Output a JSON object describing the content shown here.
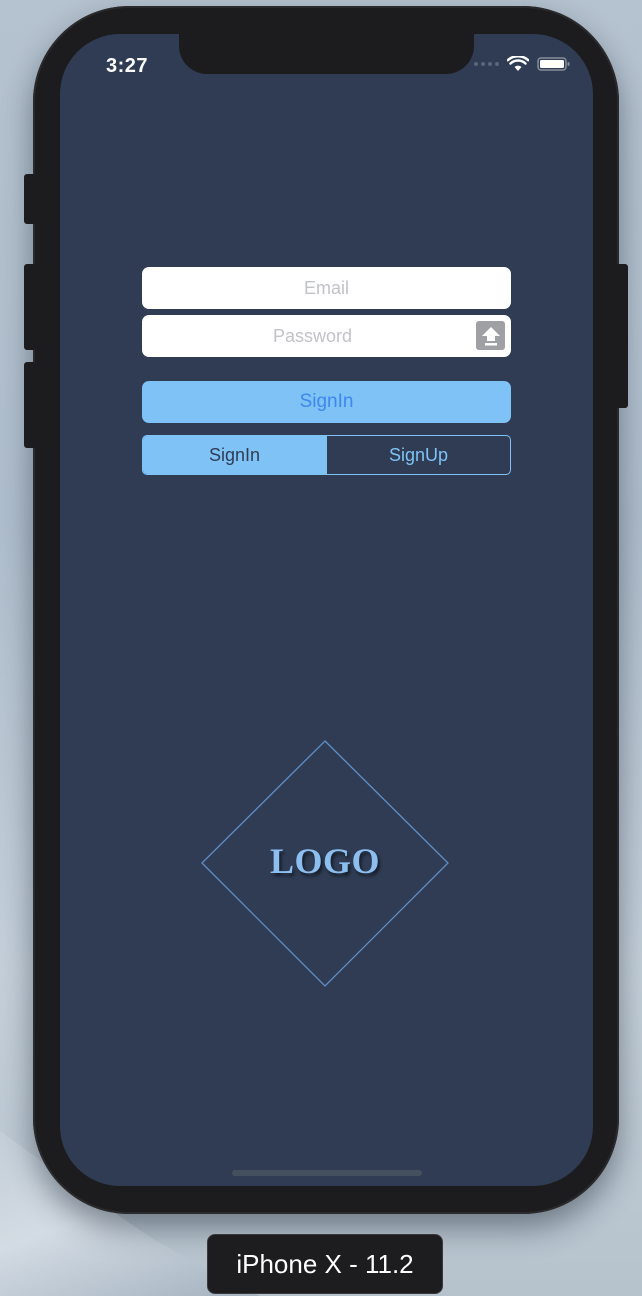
{
  "status_bar": {
    "time": "3:27"
  },
  "form": {
    "email_placeholder": "Email",
    "password_placeholder": "Password",
    "submit_label": "SignIn"
  },
  "segmented_control": {
    "selected": "SignIn",
    "options": [
      "SignIn",
      "SignUp"
    ]
  },
  "logo": {
    "text": "LOGO"
  },
  "simulator": {
    "device_label": "iPhone X - 11.2"
  },
  "colors": {
    "screen_background": "#2f3c54",
    "accent": "#7ec2f6",
    "primary_text": "#3f86f0",
    "logo_text": "#8cbff0"
  },
  "icons": {
    "password_field": "upload-arrow-icon",
    "status_wifi": "wifi-icon",
    "status_battery": "battery-icon"
  }
}
